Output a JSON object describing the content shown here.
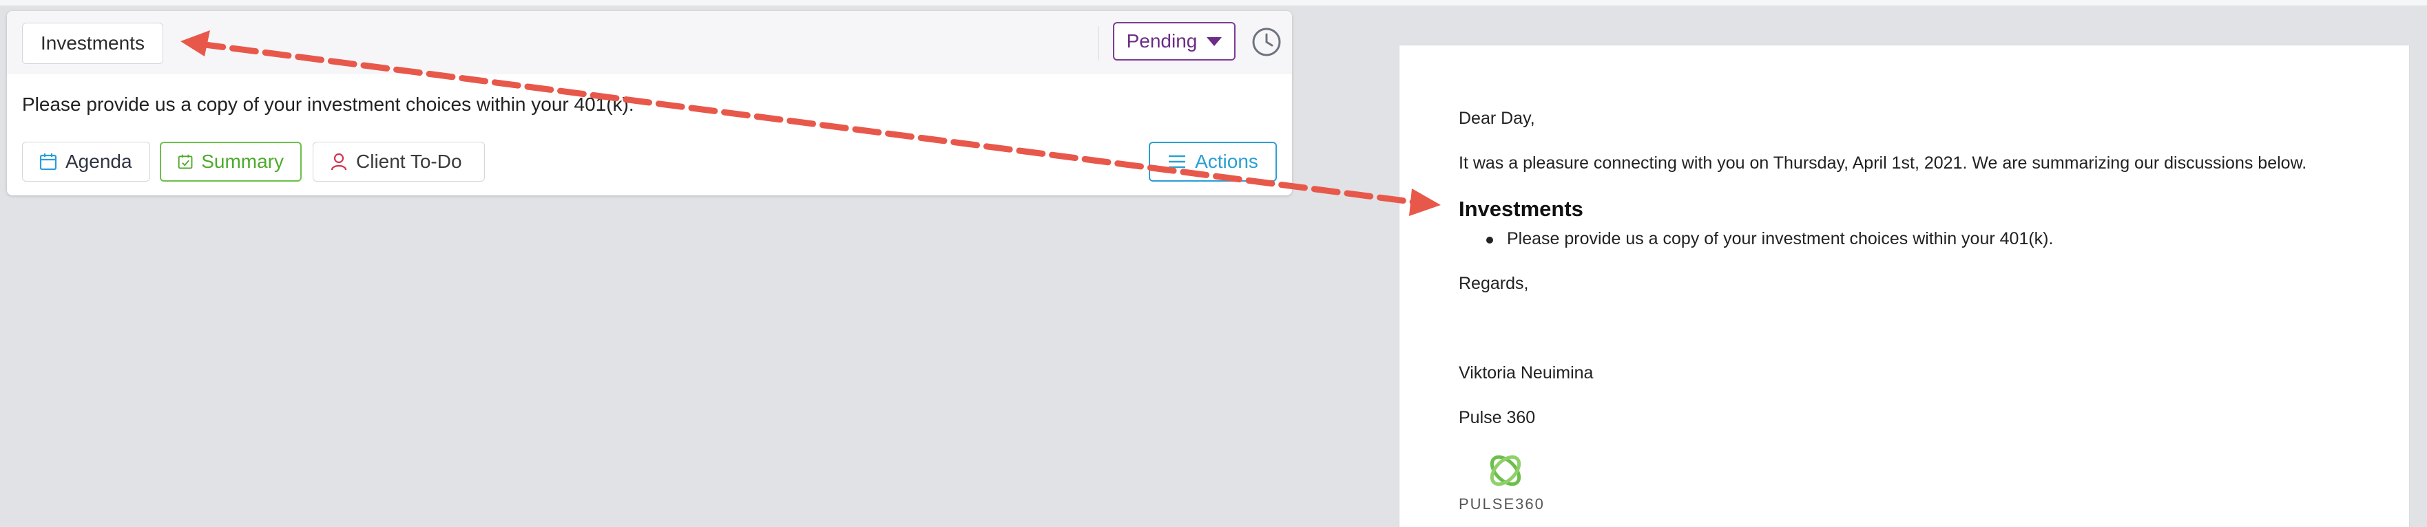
{
  "card": {
    "topic": "Investments",
    "status": "Pending",
    "description": "Please provide us a copy of your investment choices within your 401(k).",
    "tabs": {
      "agenda": "Agenda",
      "summary": "Summary",
      "todo": "Client To-Do"
    },
    "actions": "Actions"
  },
  "email": {
    "greeting": "Dear Day,",
    "intro": "It was a pleasure connecting with you on Thursday, April 1st, 2021. We are summarizing our discussions below.",
    "section_title": "Investments",
    "bullet": "Please provide us a copy of your investment choices within your 401(k).",
    "closing": "Regards,",
    "signature_name": "Viktoria Neuimina",
    "signature_company": "Pulse 360",
    "logo_text": "PULSE360"
  },
  "colors": {
    "status_purple": "#6b2d86",
    "summary_green": "#4eaa2a",
    "actions_blue": "#2a9fd6",
    "annotation_red": "#e8584a"
  },
  "icons": {
    "agenda": "calendar-icon",
    "summary": "check-calendar-icon",
    "todo": "person-icon",
    "actions": "list-icon",
    "history": "clock-icon",
    "dropdown": "caret-down-icon"
  }
}
